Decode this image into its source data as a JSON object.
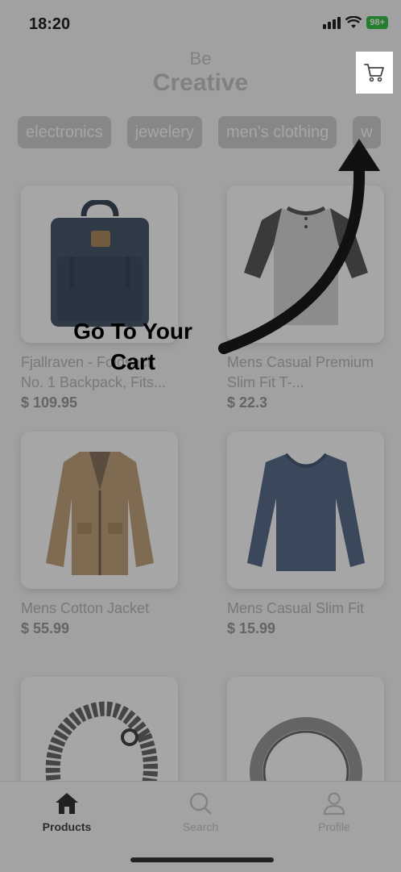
{
  "status_bar": {
    "time": "18:20",
    "battery": "98+"
  },
  "header": {
    "brand_small": "Be",
    "brand_large": "Creative"
  },
  "categories": [
    "electronics",
    "jewelery",
    "men's clothing",
    "w"
  ],
  "products": [
    {
      "title": "Fjallraven - Foldsack No. 1 Backpack, Fits...",
      "price": "$ 109.95",
      "image_icon": "backpack-image"
    },
    {
      "title": "Mens Casual Premium Slim Fit T-...",
      "price": "$ 22.3",
      "image_icon": "tshirt-image"
    },
    {
      "title": "Mens Cotton Jacket",
      "price": "$ 55.99",
      "image_icon": "jacket-image"
    },
    {
      "title": "Mens Casual Slim Fit",
      "price": "$ 15.99",
      "image_icon": "longsleeve-image"
    },
    {
      "title": "",
      "price": "",
      "image_icon": "bracelet-image"
    },
    {
      "title": "",
      "price": "",
      "image_icon": "ring-image"
    }
  ],
  "tabs": [
    {
      "label": "Products",
      "icon": "home-icon",
      "active": true
    },
    {
      "label": "Search",
      "icon": "search-icon",
      "active": false
    },
    {
      "label": "Profile",
      "icon": "profile-icon",
      "active": false
    }
  ],
  "tutorial": {
    "text": "Go To Your Cart"
  },
  "colors": {
    "overlay": "#000000",
    "accent": "#3ac24a"
  }
}
